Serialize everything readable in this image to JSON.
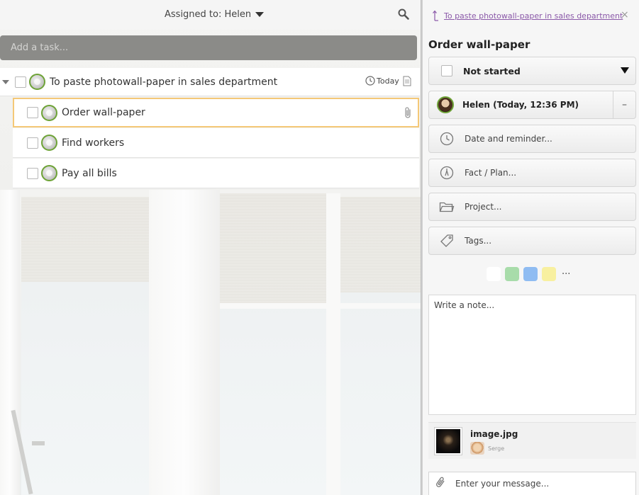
{
  "header": {
    "assigned_label": "Assigned to: Helen"
  },
  "add_task": {
    "placeholder": "Add a task..."
  },
  "task_list": {
    "parent": {
      "label": "To paste photowall-paper in sales department",
      "due": "Today"
    },
    "children": [
      {
        "label": "Order wall-paper"
      },
      {
        "label": "Find workers"
      },
      {
        "label": "Pay all bills"
      }
    ]
  },
  "detail": {
    "parent_link": "To paste photowall-paper in sales department",
    "close_glyph": "×",
    "title": "Order wall-paper",
    "status": "Not started",
    "assignee": "Helen (Today, 12:36 PM)",
    "assignee_remove": "–",
    "date_label": "Date and reminder...",
    "fact_label": "Fact / Plan...",
    "project_label": "Project...",
    "tags_label": "Tags...",
    "colors": [
      "#ffffff",
      "#a8dcaa",
      "#8fbcf2",
      "#f8f0a0"
    ],
    "more_colors": "···",
    "note_placeholder": "Write a note...",
    "attachment": {
      "name": "image.jpg",
      "user": "Serge"
    },
    "message_placeholder": "Enter your message..."
  },
  "icons": {
    "search": "search-icon",
    "clock": "clock-icon",
    "note": "note-icon",
    "paperclip": "paperclip-icon",
    "folder": "folder-icon",
    "tag": "tag-icon",
    "compass": "compass-icon"
  }
}
